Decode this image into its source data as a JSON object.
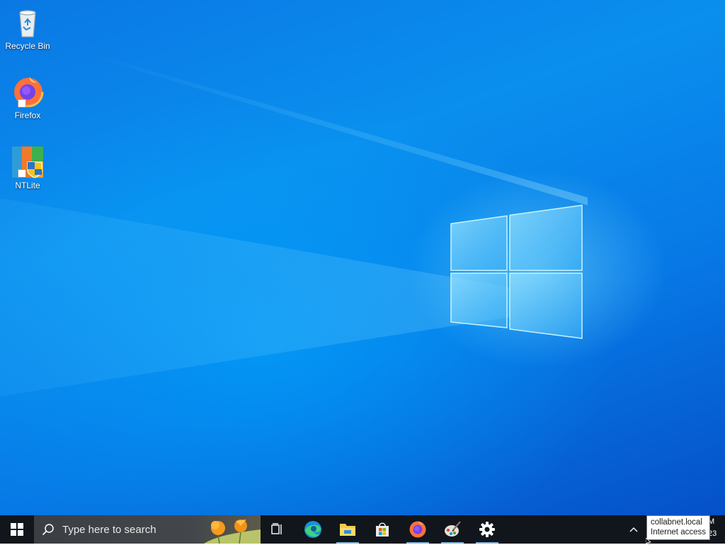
{
  "desktop": {
    "icons": [
      {
        "label": "Recycle Bin",
        "icon": "recycle-bin-icon"
      },
      {
        "label": "Firefox",
        "icon": "firefox-icon"
      },
      {
        "label": "NTLite",
        "icon": "ntlite-icon"
      }
    ]
  },
  "taskbar": {
    "search_placeholder": "Type here to search",
    "apps": [
      {
        "name": "Task View",
        "icon": "task-view-icon"
      },
      {
        "name": "Microsoft Edge",
        "icon": "edge-icon"
      },
      {
        "name": "File Explorer",
        "icon": "file-explorer-icon"
      },
      {
        "name": "Microsoft Store",
        "icon": "store-icon"
      },
      {
        "name": "Firefox",
        "icon": "firefox-icon"
      },
      {
        "name": "Paint",
        "icon": "paint-icon"
      },
      {
        "name": "Settings",
        "icon": "gear-icon"
      }
    ],
    "clock": {
      "time_fragment": "M",
      "date_fragment": "23"
    }
  },
  "tooltip": {
    "line1": "collabnet.local",
    "line2": "Internet access"
  },
  "colors": {
    "desktop_blue": "#0a78e4",
    "taskbar": "#10161c",
    "accent": "#8ab4d8"
  }
}
